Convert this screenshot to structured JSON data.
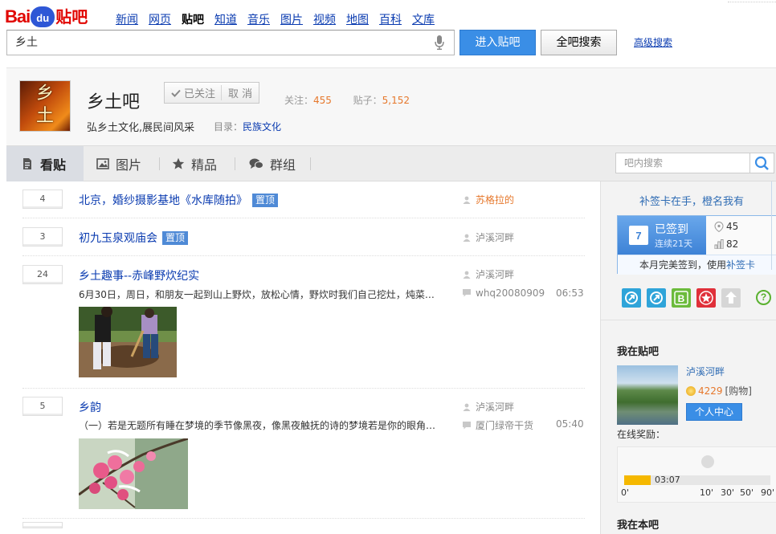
{
  "logo": {
    "bai": "Bai",
    "du": "du",
    "tieba": "贴吧"
  },
  "nav": [
    {
      "label": "新闻",
      "active": false
    },
    {
      "label": "网页",
      "active": false
    },
    {
      "label": "贴吧",
      "active": true
    },
    {
      "label": "知道",
      "active": false
    },
    {
      "label": "音乐",
      "active": false
    },
    {
      "label": "图片",
      "active": false
    },
    {
      "label": "视频",
      "active": false
    },
    {
      "label": "地图",
      "active": false
    },
    {
      "label": "百科",
      "active": false
    },
    {
      "label": "文库",
      "active": false
    }
  ],
  "search": {
    "value": "乡土",
    "enter_label": "进入贴吧",
    "all_label": "全吧搜索",
    "advanced_label": "高级搜索"
  },
  "forum": {
    "avatar_chars": [
      "乡",
      "土"
    ],
    "name": "乡土吧",
    "follow_label": "已关注",
    "cancel_label": "取 消",
    "follow_text": "关注：",
    "follow_count": "455",
    "posts_text": "贴子：",
    "posts_count": "5,152",
    "slogan": "弘乡土文化,展民间风采",
    "catalog_label": "目录：",
    "catalog_value": "民族文化"
  },
  "tabs": [
    {
      "label": "看贴",
      "icon": "document-icon",
      "active": true
    },
    {
      "label": "图片",
      "icon": "image-icon",
      "active": false
    },
    {
      "label": "精品",
      "icon": "star-icon",
      "active": false
    },
    {
      "label": "群组",
      "icon": "chat-icon",
      "active": false
    }
  ],
  "in_search": {
    "placeholder": "吧内搜索"
  },
  "threads": [
    {
      "replies": "4",
      "title": "北京，婚纱摄影基地《水库随拍》",
      "badge": "置顶",
      "author": "苏格拉的",
      "author_highlight": true
    },
    {
      "replies": "3",
      "title": "初九玉泉观庙会",
      "badge": "置顶",
      "author": "泸溪河畔",
      "author_highlight": false
    },
    {
      "replies": "24",
      "title": "乡土趣事--赤峰野炊纪实",
      "badge": "",
      "author": "泸溪河畔",
      "abstract": "6月30日，周日，和朋友一起到山上野炊，放松心情，野炊时我们自己挖灶，炖菜…",
      "last_reply": "whq20080909",
      "time": "06:53",
      "author_highlight": false
    },
    {
      "replies": "5",
      "title": "乡韵",
      "badge": "",
      "author": "泸溪河畔",
      "abstract": "（一）若是无题所有睡在梦境的季节像黑夜，像黑夜触抚的诗的梦境若是你的眼角…",
      "last_reply": "厦门绿帝干货",
      "time": "05:40",
      "author_highlight": false
    }
  ],
  "sidebar": {
    "promo": "补签卡在手，橙名我有",
    "sign_state": "已签到",
    "sign_days": "连续21天",
    "calendar_day": "7",
    "rank": "45",
    "count": "82",
    "foot_text": "本月完美签到，使用",
    "foot_link": "补签卡",
    "help": "?",
    "my_tieba_title": "我在贴吧",
    "user_name": "泸溪河畔",
    "coins": "4229",
    "shop": "[购物]",
    "center_button": "个人中心",
    "online_label": "在线奖励：",
    "online_progress": 0.18,
    "online_time": "03:07",
    "ticks": [
      "0'",
      "10'",
      "30'",
      "50'",
      "90'"
    ],
    "in_this_bar_title": "我在本吧"
  },
  "colors": {
    "brand_red": "#e10601",
    "brand_blue": "#2e57d6",
    "link": "#0a3bb0",
    "accent_orange": "#e6782c",
    "button_blue": "#3a8ee6"
  }
}
